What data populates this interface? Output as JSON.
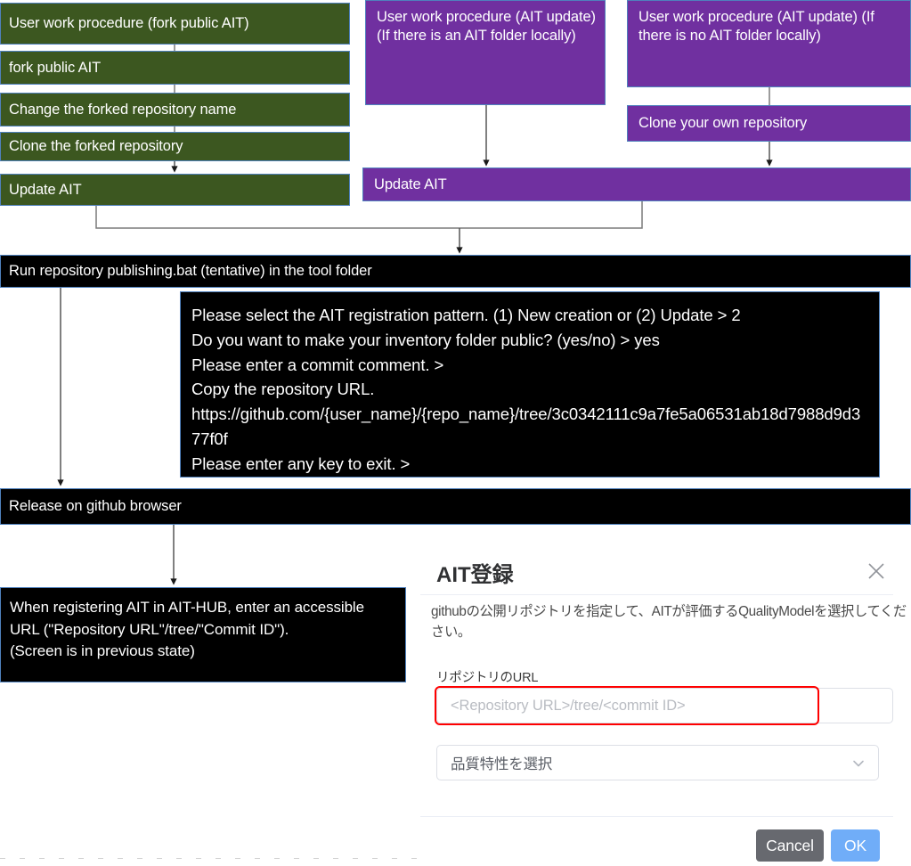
{
  "diagram": {
    "title": "AIT registration / update workflow",
    "colors": {
      "green": "#3c5720",
      "purple": "#7030a0",
      "black": "#000000",
      "border": "#4f81bd",
      "arrow": "#404040",
      "highlight": "#ff0000",
      "ok_button": "#70adf8",
      "cancel_button": "#67696f"
    },
    "columns": {
      "fork_flow": [
        {
          "id": "fork-header",
          "label": "User work procedure (fork public AIT)"
        },
        {
          "id": "fork-public-ait",
          "label": "fork public AIT"
        },
        {
          "id": "change-repo-name",
          "label": "Change the forked repository name"
        },
        {
          "id": "clone-forked",
          "label": "Clone the forked repository"
        },
        {
          "id": "update-ait-green",
          "label": "Update AIT"
        }
      ],
      "update_local_flow": [
        {
          "id": "update-local-header",
          "label": "User work procedure (AIT update) (If there is an AIT folder locally)"
        }
      ],
      "update_nolocal_flow": [
        {
          "id": "update-nolocal-header",
          "label": "User work procedure (AIT update) (If there is no AIT folder locally)"
        },
        {
          "id": "clone-own-repo",
          "label": "Clone your own repository"
        }
      ],
      "update_ait_purple": {
        "id": "update-ait-purple",
        "label": "Update AIT"
      }
    },
    "steps": {
      "run_bat": "Run repository publishing.bat (tentative) in the tool folder",
      "release_github": "Release on github browser"
    },
    "console": {
      "lines": [
        "Please select the AIT registration pattern. (1) New creation or (2) Update > 2",
        "Do you want to make your inventory folder public? (yes/no) > yes",
        "Please enter a commit comment. >",
        "Copy the repository URL.",
        "https://github.com/{user_name}/{repo_name}/tree/3c0342111c9a7fe5a06531ab18d7988d9d377f0f",
        "Please enter any key to exit. >"
      ]
    },
    "note": {
      "lines": [
        "When registering AIT in AIT-HUB, enter an accessible",
        "URL (\"Repository URL\"/tree/\"Commit ID\").",
        "(Screen is in previous state)"
      ]
    }
  },
  "dialog": {
    "title": "AIT登録",
    "close_icon": "close-icon",
    "description": "githubの公開リポジトリを指定して、AITが評価するQualityModelを選択してください。",
    "url_field": {
      "label": "リポジトリのURL",
      "value": "",
      "placeholder": "<Repository URL>/tree/<commit ID>"
    },
    "quality_select": {
      "selected": "品質特性を選択",
      "caret_icon": "chevron-down-icon"
    },
    "buttons": {
      "cancel": "Cancel",
      "ok": "OK"
    }
  }
}
